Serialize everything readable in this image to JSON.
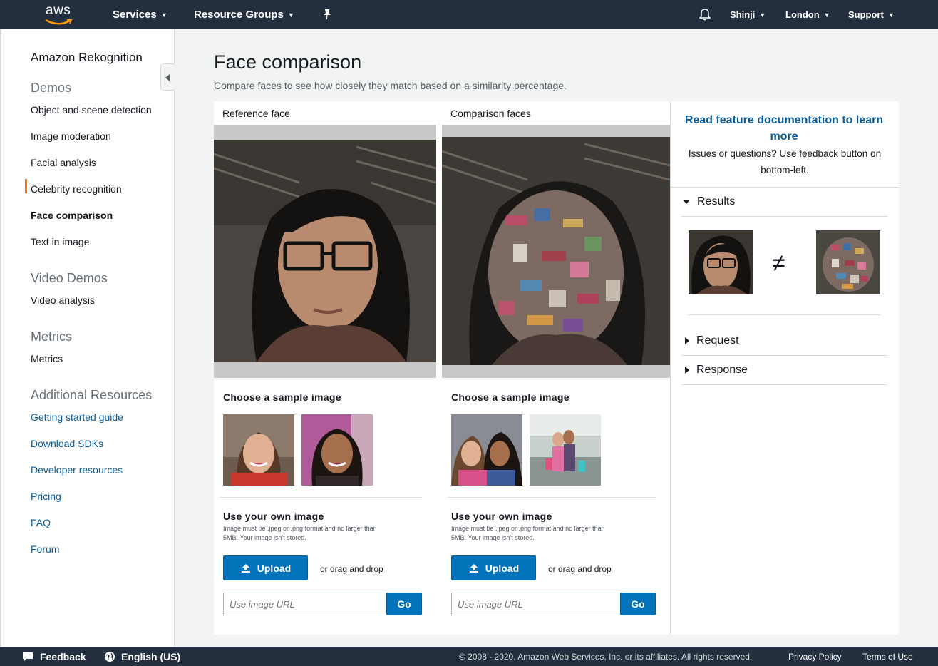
{
  "nav": {
    "logo": "aws",
    "services": "Services",
    "resource_groups": "Resource Groups",
    "user": "Shinji",
    "region": "London",
    "support": "Support"
  },
  "sidebar": {
    "app_title": "Amazon Rekognition",
    "demos_header": "Demos",
    "demos": [
      "Object and scene detection",
      "Image moderation",
      "Facial analysis",
      "Celebrity recognition",
      "Face comparison",
      "Text in image"
    ],
    "video_header": "Video Demos",
    "video_items": [
      "Video analysis"
    ],
    "metrics_header": "Metrics",
    "metrics_items": [
      "Metrics"
    ],
    "resources_header": "Additional Resources",
    "resources": [
      "Getting started guide",
      "Download SDKs",
      "Developer resources",
      "Pricing",
      "FAQ",
      "Forum"
    ]
  },
  "main": {
    "title": "Face comparison",
    "subtitle": "Compare faces to see how closely they match based on a similarity percentage.",
    "reference": {
      "heading": "Reference face",
      "choose_title": "Choose a sample image",
      "own_title": "Use your own image",
      "own_note": "Image must be .jpeg or .png format and no larger than 5MB. Your image isn't stored.",
      "upload_label": "Upload",
      "drag_text": "or drag and drop",
      "url_placeholder": "Use image URL",
      "go_label": "Go"
    },
    "comparison": {
      "heading": "Comparison faces",
      "choose_title": "Choose a sample image",
      "own_title": "Use your own image",
      "own_note": "Image must be .jpeg or .png format and no larger than 5MB. Your image isn't stored.",
      "upload_label": "Upload",
      "drag_text": "or drag and drop",
      "url_placeholder": "Use image URL",
      "go_label": "Go"
    }
  },
  "right_panel": {
    "doc_link": "Read feature documentation to learn more",
    "issues": "Issues or questions? Use feedback button on bottom-left.",
    "results_label": "Results",
    "match_symbol": "≠",
    "request_label": "Request",
    "response_label": "Response"
  },
  "footer": {
    "feedback": "Feedback",
    "language": "English (US)",
    "copyright": "© 2008 - 2020, Amazon Web Services, Inc. or its affiliates. All rights reserved.",
    "privacy": "Privacy Policy",
    "terms": "Terms of Use"
  },
  "colors": {
    "nav_bg": "#232f3e",
    "link_blue": "#0a5d9b",
    "button_blue": "#0073bb",
    "active_accent": "#ec7211"
  }
}
